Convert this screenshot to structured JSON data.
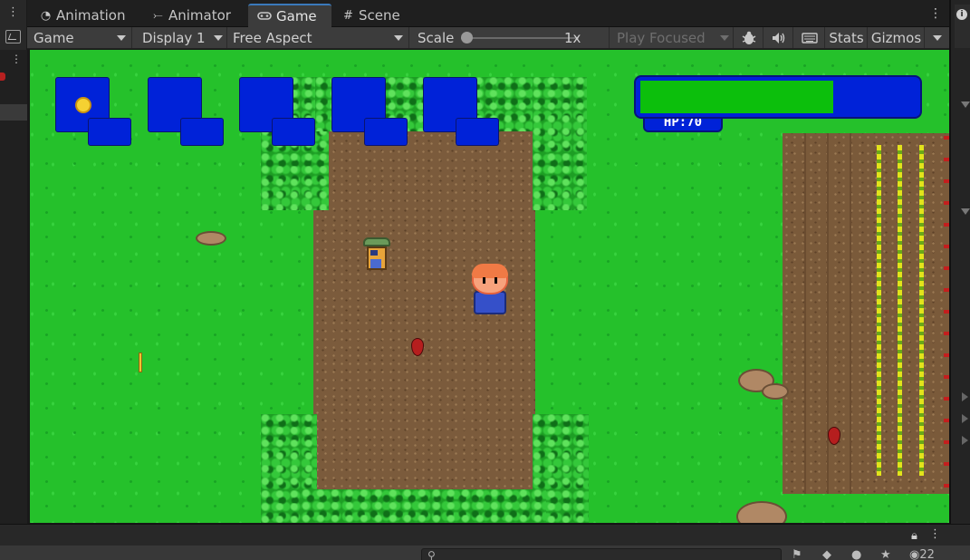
{
  "tabs": [
    {
      "label": "Animation",
      "icon": "clock-icon",
      "active": false
    },
    {
      "label": "Animator",
      "icon": "animator-icon",
      "active": false
    },
    {
      "label": "Game",
      "icon": "gamepad-icon",
      "active": true
    },
    {
      "label": "Scene",
      "icon": "grid-icon",
      "active": false
    }
  ],
  "toolbar": {
    "display_mode": "Game",
    "display": "Display 1",
    "aspect": "Free Aspect",
    "scale_label": "Scale",
    "scale_value": "1x",
    "scale_fraction": 0.0,
    "play_mode": "Play Focused",
    "stats": "Stats",
    "gizmos": "Gizmos"
  },
  "game": {
    "hp_text": "HP:70",
    "hp_fraction": 0.7,
    "inventory_slots": 5,
    "colors": {
      "grass": "#25c12b",
      "ui_blue": "#0022d8",
      "hp_green": "#0cbf0c",
      "dirt": "#7b5b3c"
    }
  },
  "bottom": {
    "search_placeholder": "",
    "hidden_count": "22"
  }
}
